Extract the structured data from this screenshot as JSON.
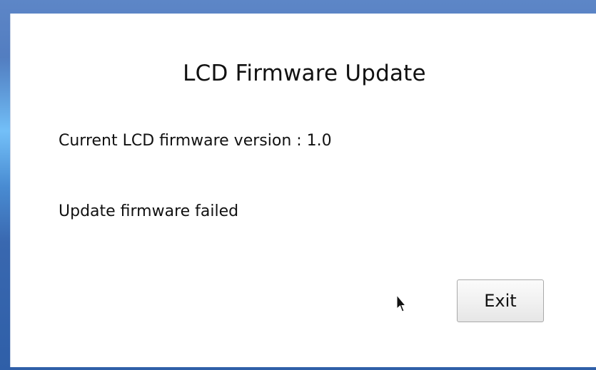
{
  "dialog": {
    "title": "LCD Firmware Update",
    "version_label": "Current LCD firmware version : ",
    "version_value": "1.0",
    "status_message": "Update firmware failed",
    "exit_label": "Exit"
  },
  "icons": {
    "cursor": "mouse-pointer-icon"
  },
  "colors": {
    "desktop_background": "#3f6db4",
    "dialog_background": "#ffffff",
    "text": "#111111"
  }
}
